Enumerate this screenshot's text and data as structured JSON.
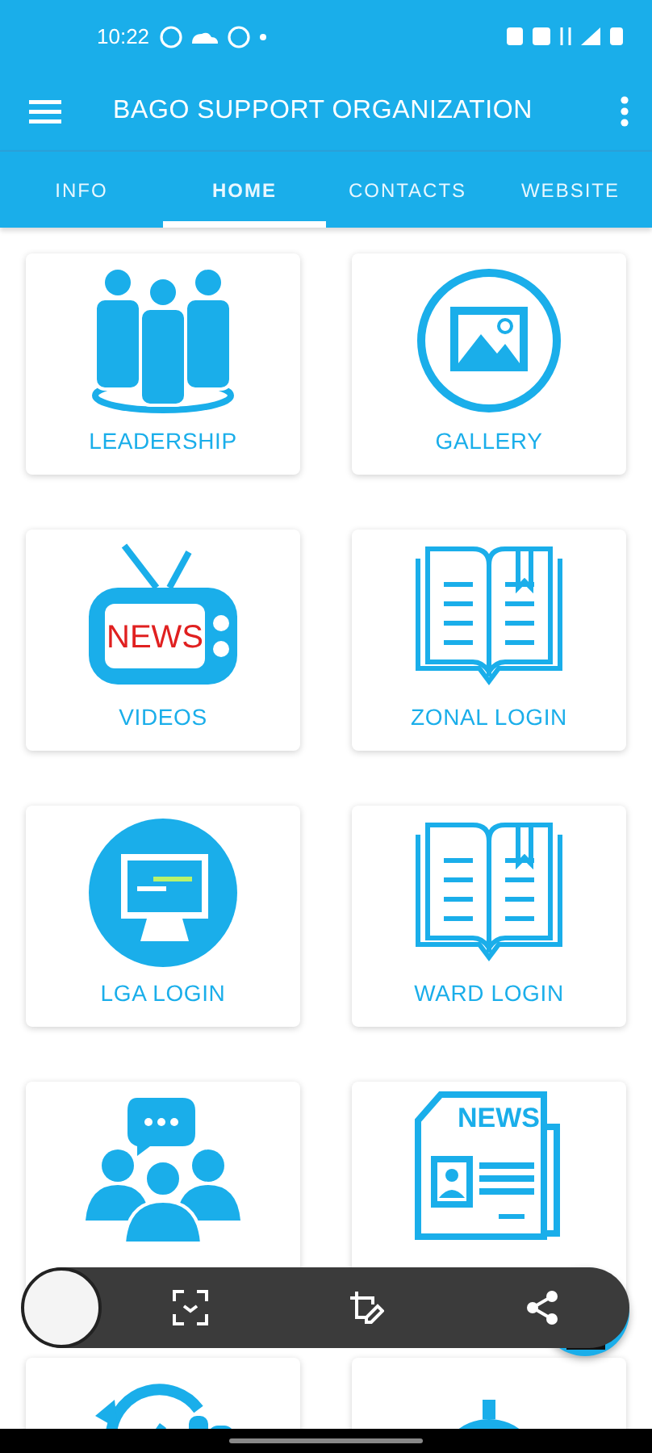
{
  "status_bar": {
    "time": "10:22"
  },
  "app_bar": {
    "title": "BAGO SUPPORT ORGANIZATION"
  },
  "tabs": [
    {
      "label": "INFO",
      "selected": false
    },
    {
      "label": "HOME",
      "selected": true
    },
    {
      "label": "CONTACTS",
      "selected": false
    },
    {
      "label": "WEBSITE",
      "selected": false
    }
  ],
  "tiles": [
    {
      "kind": "leaders",
      "label": "LEADERSHIP"
    },
    {
      "kind": "gallery",
      "label": "GALLERY"
    },
    {
      "kind": "tv",
      "label": "VIDEOS",
      "icon_text": "NEWS"
    },
    {
      "kind": "book",
      "label": "ZONAL LOGIN"
    },
    {
      "kind": "monitor",
      "label": "LGA LOGIN"
    },
    {
      "kind": "book",
      "label": "WARD LOGIN"
    },
    {
      "kind": "group"
    },
    {
      "kind": "newspaper",
      "icon_text": "NEWS"
    },
    {
      "kind": "clock"
    },
    {
      "kind": "dome"
    }
  ]
}
